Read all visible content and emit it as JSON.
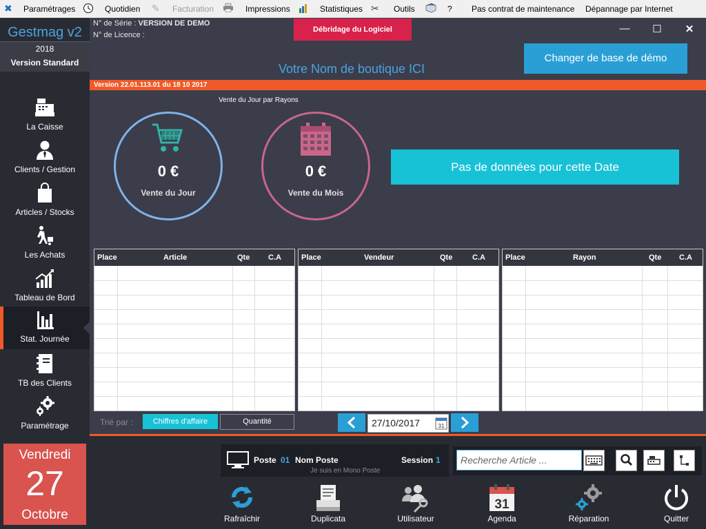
{
  "menubar": {
    "items": [
      "Paramétrages",
      "Quotidien",
      "Facturation",
      "Impressions",
      "Statistiques",
      "Outils",
      "?",
      "Pas contrat de maintenance",
      "Dépannage par Internet"
    ]
  },
  "brand": {
    "name": "Gestmag v2",
    "year": "2018",
    "edition": "Version Standard"
  },
  "sidebar": {
    "items": [
      {
        "label": "La Caisse",
        "icon": "cash-register-icon"
      },
      {
        "label": "Clients / Gestion",
        "icon": "user-icon"
      },
      {
        "label": "Articles / Stocks",
        "icon": "shopping-bag-icon"
      },
      {
        "label": "Les Achats",
        "icon": "delivery-icon"
      },
      {
        "label": "Tableau de Bord",
        "icon": "chart-up-icon"
      },
      {
        "label": "Stat. Journée",
        "icon": "bar-chart-icon"
      },
      {
        "label": "TB des Clients",
        "icon": "notebook-icon"
      },
      {
        "label": "Paramétrage",
        "icon": "gears-icon"
      }
    ],
    "active_index": 5
  },
  "date": {
    "day_name": "Vendredi",
    "day": "27",
    "month": "Octobre"
  },
  "header": {
    "serial_label": "N° de Série : ",
    "serial_value": "VERSION DE DEMO",
    "licence_label": "N° de Licence :",
    "unlock_label": "Débridage du Logiciel",
    "demo_button": "Changer de base de démo",
    "shop_name": "Votre Nom de boutique ICI",
    "version": "Version 22.01.113.01 du 18 10 2017"
  },
  "window": {
    "minimize": "—",
    "maximize": "☐",
    "close": "✕"
  },
  "stats": {
    "section_label": "Vente du Jour par Rayons",
    "day": {
      "value": "0 €",
      "label": "Vente du Jour",
      "color": "#7fb3e8"
    },
    "month": {
      "value": "0 €",
      "label": "Vente du Mois",
      "color": "#c9668a"
    },
    "no_data": "Pas de données pour cette Date"
  },
  "tables": [
    {
      "headers": [
        "Place",
        "Article",
        "Qte",
        "C.A"
      ]
    },
    {
      "headers": [
        "Place",
        "Vendeur",
        "Qte",
        "C.A"
      ]
    },
    {
      "headers": [
        "Place",
        "Rayon",
        "Qte",
        "C.A"
      ]
    }
  ],
  "sort": {
    "label": "Trié par :",
    "option_ca": "Chiffres d'affaire",
    "option_qte": "Quantité"
  },
  "date_picker": {
    "value": "27/10/2017",
    "cal_day": "31"
  },
  "poste": {
    "poste_label": "Poste",
    "poste_num": "01",
    "nom_label": "Nom Poste",
    "session_label": "Session",
    "session_num": "1",
    "mono": "Je suis en Mono Poste"
  },
  "search": {
    "placeholder": "Recherche Article ..."
  },
  "toolbar": [
    "Rafraîchir",
    "Duplicata",
    "Utilisateur",
    "Agenda",
    "Réparation",
    "Quitter"
  ],
  "agenda_day": "31",
  "colors": {
    "accent": "#f05a28",
    "blue": "#2a9fd6",
    "cyan": "#17c1d6",
    "red": "#d8224b"
  }
}
